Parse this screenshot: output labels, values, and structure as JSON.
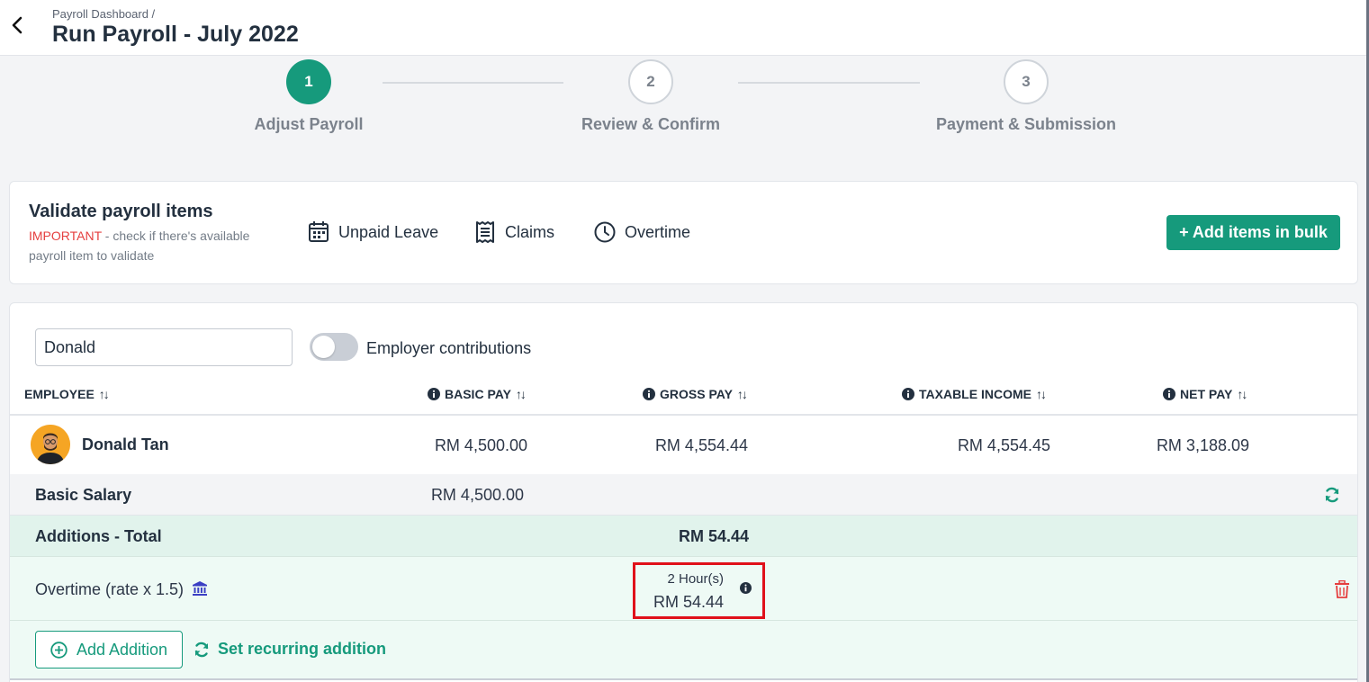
{
  "header": {
    "breadcrumb": "Payroll Dashboard  /",
    "title": "Run Payroll - July 2022"
  },
  "stepper": [
    {
      "number": "1",
      "label": "Adjust Payroll",
      "active": true
    },
    {
      "number": "2",
      "label": "Review & Confirm",
      "active": false
    },
    {
      "number": "3",
      "label": "Payment & Submission",
      "active": false
    }
  ],
  "validate": {
    "title": "Validate payroll items",
    "important": "IMPORTANT",
    "description": " - check if there's available payroll item to validate",
    "links": {
      "unpaid_leave": "Unpaid Leave",
      "claims": "Claims",
      "overtime": "Overtime"
    },
    "bulk_button": "+ Add items in bulk"
  },
  "table": {
    "search_value": "Donald",
    "toggle_label": "Employer contributions",
    "toggle_on": false,
    "columns": {
      "employee": "EMPLOYEE",
      "basic_pay": "BASIC PAY",
      "gross_pay": "GROSS PAY",
      "taxable_income": "TAXABLE INCOME",
      "net_pay": "NET PAY"
    },
    "employee": {
      "name": "Donald Tan",
      "basic_pay": "RM 4,500.00",
      "gross_pay": "RM 4,554.44",
      "taxable_income": "RM 4,554.45",
      "net_pay": "RM 3,188.09"
    },
    "basic_salary": {
      "label": "Basic Salary",
      "amount": "RM 4,500.00"
    },
    "additions_total": {
      "label": "Additions - Total",
      "amount": "RM 54.44"
    },
    "overtime": {
      "label": "Overtime (rate x 1.5)",
      "hours": "2 Hour(s)",
      "amount": "RM 54.44"
    },
    "add_addition": "Add Addition",
    "set_recurring": "Set recurring addition"
  },
  "colors": {
    "accent": "#169a7c",
    "important": "#e53e3e",
    "highlight_box": "#e0101a",
    "delete": "#e53e3e",
    "bank_icon": "#3b3fc4"
  }
}
